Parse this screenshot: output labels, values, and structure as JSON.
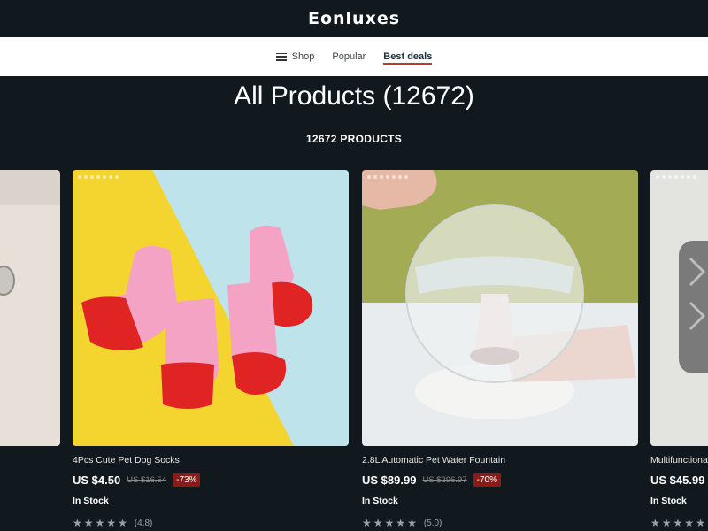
{
  "header": {
    "brand": "Eonluxes"
  },
  "nav": {
    "items": [
      {
        "label": "Shop",
        "icon": "menu-icon"
      },
      {
        "label": "Popular"
      },
      {
        "label": "Best deals",
        "active": true
      }
    ]
  },
  "page": {
    "title": "All Products",
    "title_count": "(12672)",
    "subtitle": "12672 PRODUCTS"
  },
  "products": [
    {
      "name": "4Pcs Cute Pet Dog Socks",
      "price": "US $4.50",
      "old_price": "US $16.54",
      "discount": "-73%",
      "stock": "In Stock",
      "rating": "(4.8)"
    },
    {
      "name": "2.8L Automatic Pet Water Fountain",
      "price": "US $89.99",
      "old_price": "US $296.97",
      "discount": "-70%",
      "stock": "In Stock",
      "rating": "(5.0)"
    },
    {
      "name": "Multifunctional",
      "price": "US $45.99",
      "stock": "In Stock"
    }
  ],
  "colors": {
    "background": "#12191e",
    "accent": "#c0392b",
    "discount_bg": "#8b1a1a"
  }
}
